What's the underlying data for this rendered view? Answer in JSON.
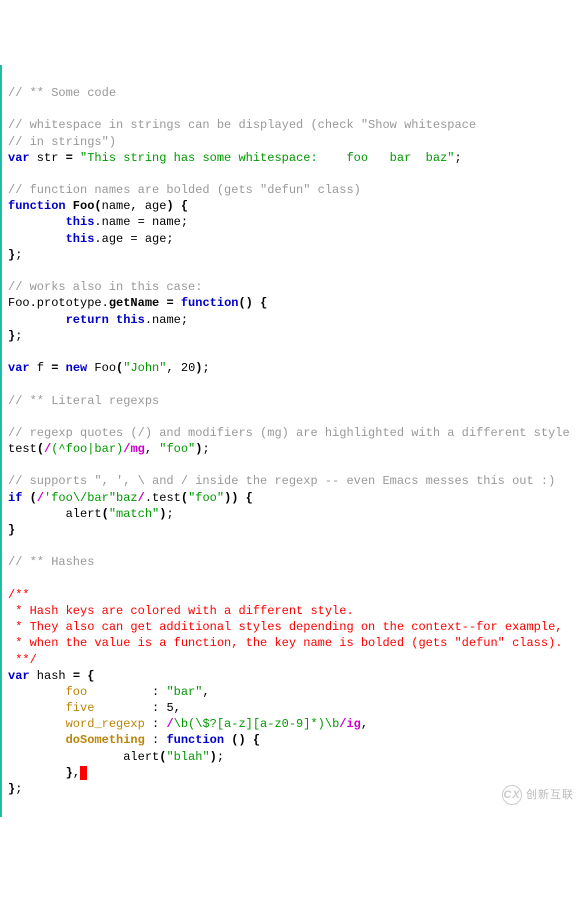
{
  "lines": {
    "l1": "// ** Some code",
    "l2": "",
    "l3a": "// whitespace in strings can be displayed (check \"Show whitespace",
    "l3b": "// in strings\")",
    "l4_var": "var",
    "l4_name": " str ",
    "l4_eq": "=",
    "l4_str": " \"This string has some whitespace:    foo   bar  baz\"",
    "l4_sc": ";",
    "l5": "",
    "l6": "// function names are bolded (gets \"defun\" class)",
    "l7_fn": "function",
    "l7_name": " Foo",
    "l7_paren": "(",
    "l7_args": "name, age",
    "l7_close": ")",
    "l7_brace": " {",
    "l8_ind": "        ",
    "l8_this": "this",
    "l8_dot": ".",
    "l8_rest": "name = name;",
    "l9_ind": "        ",
    "l9_this": "this",
    "l9_dot": ".",
    "l9_rest": "age = age;",
    "l10_close": "}",
    "l10_sc": ";",
    "l11": "",
    "l12": "// works also in this case:",
    "l13_a": "Foo.prototype.",
    "l13_def": "getName",
    "l13_eq": " = ",
    "l13_fn": "function",
    "l13_p": "()",
    "l13_br": " {",
    "l14_ind": "        ",
    "l14_ret": "return",
    "l14_sp": " ",
    "l14_this": "this",
    "l14_dot": ".",
    "l14_rest": "name;",
    "l15_close": "}",
    "l15_sc": ";",
    "l16": "",
    "l17_var": "var",
    "l17_name": " f ",
    "l17_eq": "=",
    "l17_sp": " ",
    "l17_new": "new",
    "l17_foo": " Foo",
    "l17_op": "(",
    "l17_str": "\"John\"",
    "l17_comma": ", 20",
    "l17_cp": ")",
    "l17_sc": ";",
    "l18": "",
    "l19": "// ** Literal regexps",
    "l20": "",
    "l21": "// regexp quotes (/) and modifiers (mg) are highlighted with a different style",
    "l22_a": "test",
    "l22_op": "(",
    "l22_d1": "/",
    "l22_re": "(^foo|bar)",
    "l22_d2": "/",
    "l22_fl": "mg",
    "l22_c": ", ",
    "l22_s": "\"foo\"",
    "l22_cp": ")",
    "l22_sc": ";",
    "l23": "",
    "l24": "// supports \", ', \\ and / inside the regexp -- even Emacs messes this out :)",
    "l25_if": "if",
    "l25_sp": " ",
    "l25_op": "(",
    "l25_d1": "/",
    "l25_re": "'foo\\/bar\"baz",
    "l25_d2": "/",
    "l25_dot": ".",
    "l25_test": "test",
    "l25_op2": "(",
    "l25_s": "\"foo\"",
    "l25_cp2": ")",
    "l25_cp": ")",
    "l25_br": " {",
    "l26_ind": "        ",
    "l26_al": "alert",
    "l26_op": "(",
    "l26_s": "\"match\"",
    "l26_cp": ")",
    "l26_sc": ";",
    "l27_close": "}",
    "l28": "",
    "l29": "// ** Hashes",
    "l30": "",
    "l31a": "/**",
    "l31b": " * Hash keys are colored with a different style.",
    "l31c": " * They also can get additional styles depending on the context--for example,",
    "l31d": " * when the value is a function, the key name is bolded (gets \"defun\" class).",
    "l31e": " **/",
    "l32_var": "var",
    "l32_name": " hash ",
    "l32_eq": "=",
    "l32_br": " {",
    "l33_ind": "        ",
    "l33_k": "foo",
    "l33_pad": "         ",
    "l33_col": ": ",
    "l33_v": "\"bar\"",
    "l33_c": ",",
    "l34_ind": "        ",
    "l34_k": "five",
    "l34_pad": "        ",
    "l34_col": ": ",
    "l34_v": "5",
    "l34_c": ",",
    "l35_ind": "        ",
    "l35_k": "word_regexp",
    "l35_pad": " ",
    "l35_col": ": ",
    "l35_d1": "/",
    "l35_re": "\\b(\\$?[a-z][a-z0-9]*)\\b",
    "l35_d2": "/",
    "l35_fl": "ig",
    "l35_c": ",",
    "l36_ind": "        ",
    "l36_k": "doSomething",
    "l36_pad": " ",
    "l36_col": ": ",
    "l36_fn": "function",
    "l36_p": " ()",
    "l36_br": " {",
    "l37_ind": "                ",
    "l37_al": "alert",
    "l37_op": "(",
    "l37_s": "\"blah\"",
    "l37_cp": ")",
    "l37_sc": ";",
    "l38_ind": "        ",
    "l38_close": "}",
    "l38_c": ",",
    "l38_cur": " ",
    "l39_close": "}",
    "l39_sc": ";"
  },
  "watermark": {
    "logo": "CX",
    "text": "创新互联"
  }
}
